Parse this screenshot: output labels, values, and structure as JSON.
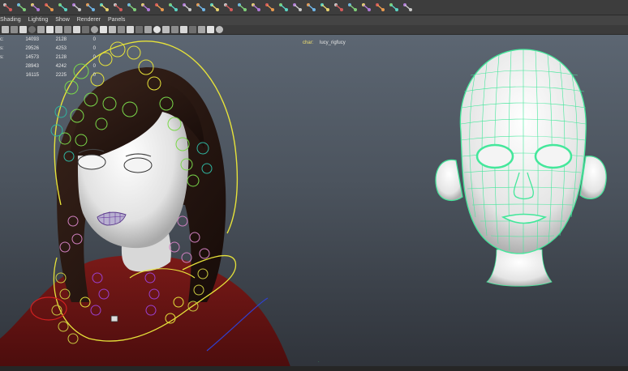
{
  "shelf": {
    "icons": [
      "joint-tool-icon",
      "ik-handle-icon",
      "ik-spline-icon",
      "insert-joint-icon",
      "mirror-joint-icon",
      "orient-joint-icon",
      "remove-joint-icon",
      "connect-joint-icon",
      "disconnect-joint-icon",
      "reroot-icon",
      "smooth-bind-icon",
      "rigid-bind-icon",
      "paint-weights-icon",
      "detach-skin-icon",
      "go-to-bindpose-icon",
      "add-influence-icon",
      "remove-influence-icon",
      "lattice-icon",
      "cluster-icon",
      "wrap-icon",
      "point-constraint-icon",
      "aim-constraint-icon",
      "orient-constraint-icon",
      "scale-constraint-icon",
      "parent-constraint-icon",
      "pole-vector-icon",
      "locator-icon",
      "set-key-icon",
      "character-set-icon",
      "hypergraph-icon"
    ]
  },
  "menubar": {
    "items": [
      "Shading",
      "Lighting",
      "Show",
      "Renderer",
      "Panels"
    ]
  },
  "viewport_toolbar": {
    "icons": [
      "select-camera-icon",
      "camera-attributes-icon",
      "bookmark-icon",
      "image-plane-icon",
      "two-d-pan-icon",
      "grid-icon",
      "film-gate-icon",
      "resolution-gate-icon",
      "gate-mask-icon",
      "field-chart-icon",
      "safe-action-icon",
      "safe-title-icon",
      "wireframe-icon",
      "smooth-shade-icon",
      "wireframe-on-shaded-icon",
      "textured-icon",
      "use-all-lights-icon",
      "shadows-icon",
      "x-ray-icon",
      "x-ray-joints-icon",
      "backface-culling-icon",
      "isolate-select-icon",
      "ambient-occlusion-icon",
      "motion-blur-icon",
      "anti-aliasing-icon"
    ]
  },
  "hud": {
    "rows": [
      {
        "label": "c:",
        "c1": "14093",
        "c2": "2128",
        "c3": "0"
      },
      {
        "label": "s:",
        "c1": "29526",
        "c2": "4253",
        "c3": "0"
      },
      {
        "label": "s:",
        "c1": "14573",
        "c2": "2128",
        "c3": "0"
      },
      {
        "label": "",
        "c1": "28943",
        "c2": "4242",
        "c3": "0"
      },
      {
        "label": "",
        "c1": "16115",
        "c2": "2225",
        "c3": "0"
      }
    ]
  },
  "char_label": {
    "label": "char:",
    "value": "lucy_rigfucy"
  },
  "colors": {
    "viewport_top": "#5c6672",
    "viewport_bottom": "#2f333a",
    "wireframe_green": "#44e79b",
    "skin": "#e8e8e8",
    "hair": "#2a1812",
    "shirt": "#6b1414",
    "controls_yellow": "#e6e23a"
  }
}
